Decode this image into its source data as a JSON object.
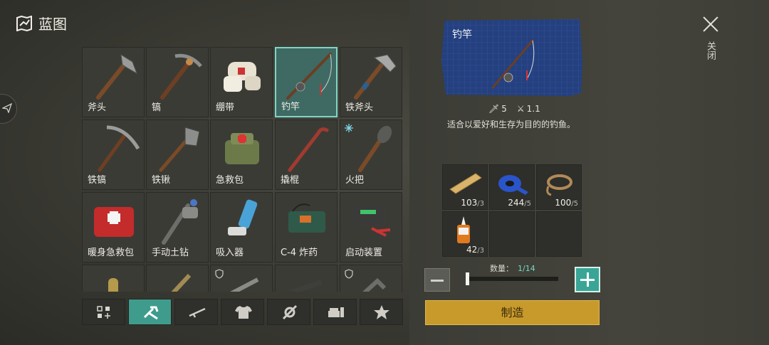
{
  "header": {
    "title": "蓝图"
  },
  "items": [
    {
      "name": "斧头",
      "selected": false
    },
    {
      "name": "镐",
      "selected": false
    },
    {
      "name": "绷带",
      "selected": false
    },
    {
      "name": "钓竿",
      "selected": true
    },
    {
      "name": "铁斧头",
      "selected": false
    },
    {
      "name": "铁镐",
      "selected": false
    },
    {
      "name": "铁锹",
      "selected": false
    },
    {
      "name": "急救包",
      "selected": false
    },
    {
      "name": "撬棍",
      "selected": false
    },
    {
      "name": "火把",
      "selected": false
    },
    {
      "name": "暖身急救包",
      "selected": false
    },
    {
      "name": "手动土钻",
      "selected": false
    },
    {
      "name": "吸入器",
      "selected": false
    },
    {
      "name": "C-4 炸药",
      "selected": false
    },
    {
      "name": "启动装置",
      "selected": false
    }
  ],
  "category_tabs": [
    {
      "icon": "all-grid-icon",
      "active": false
    },
    {
      "icon": "tools-icon",
      "active": true
    },
    {
      "icon": "weapons-icon",
      "active": false
    },
    {
      "icon": "clothing-icon",
      "active": false
    },
    {
      "icon": "parts-icon",
      "active": false
    },
    {
      "icon": "furniture-icon",
      "active": false
    },
    {
      "icon": "star-icon",
      "active": false
    }
  ],
  "detail": {
    "name": "钓竿",
    "stat_damage": "5",
    "stat_speed": "1.1",
    "description": "适合以爱好和生存为目的的钓鱼。"
  },
  "materials": [
    {
      "icon": "wood-plank-icon",
      "have": "103",
      "need": "/3"
    },
    {
      "icon": "duct-tape-icon",
      "have": "244",
      "need": "/5"
    },
    {
      "icon": "rope-icon",
      "have": "100",
      "need": "/5"
    },
    {
      "icon": "glue-icon",
      "have": "42",
      "need": "/3"
    }
  ],
  "quantity": {
    "label": "数量：",
    "value": "1/14"
  },
  "craft_button": "制造",
  "close_label": "关闭"
}
